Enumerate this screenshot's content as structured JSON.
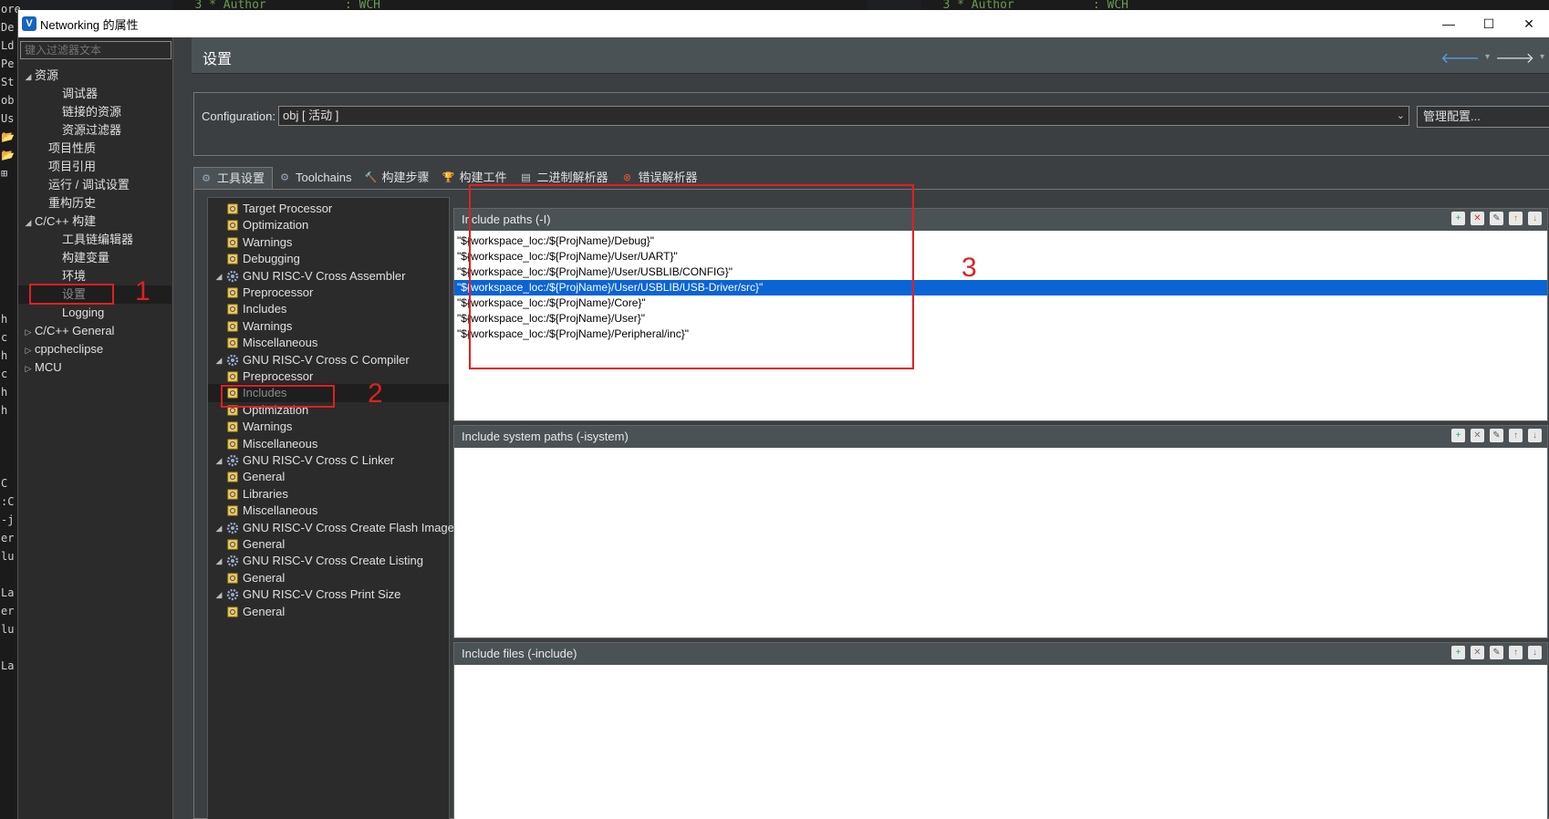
{
  "background": {
    "editor_left_text": "3 * Author           : WCH",
    "editor_right_text": "3 * Author           : WCH",
    "left_strip": [
      "ore",
      "De",
      "Ld",
      "Pe",
      "St",
      "ob",
      "Us",
      "📂",
      "📂",
      "⊞",
      "",
      "",
      "",
      "",
      "",
      "",
      "",
      "h",
      "c",
      "h",
      "c",
      "h",
      "h",
      "",
      "",
      "",
      "C",
      ":C",
      "-j",
      "er",
      "lu",
      "",
      "La",
      "er",
      "lu",
      "",
      "La"
    ]
  },
  "window": {
    "title": "Networking 的属性",
    "minimize": "—",
    "maximize": "☐",
    "close": "✕"
  },
  "leftnav": {
    "filter_placeholder": "键入过滤器文本",
    "items": [
      {
        "label": "资源",
        "indent": 0,
        "toggle": "◢"
      },
      {
        "label": "调试器",
        "indent": 2,
        "toggle": ""
      },
      {
        "label": "链接的资源",
        "indent": 2,
        "toggle": ""
      },
      {
        "label": "资源过滤器",
        "indent": 2,
        "toggle": ""
      },
      {
        "label": "项目性质",
        "indent": 1,
        "toggle": ""
      },
      {
        "label": "项目引用",
        "indent": 1,
        "toggle": ""
      },
      {
        "label": "运行 / 调试设置",
        "indent": 1,
        "toggle": ""
      },
      {
        "label": "重构历史",
        "indent": 1,
        "toggle": ""
      },
      {
        "label": "C/C++ 构建",
        "indent": 0,
        "toggle": "◢"
      },
      {
        "label": "工具链编辑器",
        "indent": 2,
        "toggle": ""
      },
      {
        "label": "构建变量",
        "indent": 2,
        "toggle": ""
      },
      {
        "label": "环境",
        "indent": 2,
        "toggle": ""
      },
      {
        "label": "设置",
        "indent": 2,
        "toggle": "",
        "selected": true
      },
      {
        "label": "Logging",
        "indent": 2,
        "toggle": ""
      },
      {
        "label": "C/C++ General",
        "indent": 0,
        "toggle": "▷"
      },
      {
        "label": "cppcheclipse",
        "indent": 0,
        "toggle": "▷"
      },
      {
        "label": "MCU",
        "indent": 0,
        "toggle": "▷"
      }
    ]
  },
  "main": {
    "title": "设置",
    "nav_back": "🡐",
    "nav_forward": "🡒",
    "nav_dropdown": "▾",
    "config_label": "Configuration:",
    "config_value": "obj  [ 活动 ]",
    "config_arrow": "⌄",
    "manage_button": "管理配置...",
    "tabs": [
      {
        "label": "工具设置",
        "icon": "⚙",
        "active": true
      },
      {
        "label": "Toolchains",
        "icon": "⚙",
        "active": false
      },
      {
        "label": "构建步骤",
        "icon": "🔨",
        "active": false
      },
      {
        "label": "构建工件",
        "icon": "🏆",
        "active": false
      },
      {
        "label": "二进制解析器",
        "icon": "▤",
        "active": false
      },
      {
        "label": "错误解析器",
        "icon": "⊗",
        "active": false
      }
    ]
  },
  "tooltree": {
    "items": [
      {
        "label": "Target Processor",
        "level": 1,
        "toggle": ""
      },
      {
        "label": "Optimization",
        "level": 1,
        "toggle": ""
      },
      {
        "label": "Warnings",
        "level": 1,
        "toggle": ""
      },
      {
        "label": "Debugging",
        "level": 1,
        "toggle": ""
      },
      {
        "label": "GNU RISC-V Cross Assembler",
        "level": 0,
        "toggle": "◢",
        "group": true
      },
      {
        "label": "Preprocessor",
        "level": 2,
        "toggle": ""
      },
      {
        "label": "Includes",
        "level": 2,
        "toggle": ""
      },
      {
        "label": "Warnings",
        "level": 2,
        "toggle": ""
      },
      {
        "label": "Miscellaneous",
        "level": 2,
        "toggle": ""
      },
      {
        "label": "GNU RISC-V Cross C Compiler",
        "level": 0,
        "toggle": "◢",
        "group": true
      },
      {
        "label": "Preprocessor",
        "level": 2,
        "toggle": ""
      },
      {
        "label": "Includes",
        "level": 2,
        "toggle": "",
        "selected": true
      },
      {
        "label": "Optimization",
        "level": 2,
        "toggle": ""
      },
      {
        "label": "Warnings",
        "level": 2,
        "toggle": ""
      },
      {
        "label": "Miscellaneous",
        "level": 2,
        "toggle": ""
      },
      {
        "label": "GNU RISC-V Cross C Linker",
        "level": 0,
        "toggle": "◢",
        "group": true
      },
      {
        "label": "General",
        "level": 2,
        "toggle": ""
      },
      {
        "label": "Libraries",
        "level": 2,
        "toggle": ""
      },
      {
        "label": "Miscellaneous",
        "level": 2,
        "toggle": ""
      },
      {
        "label": "GNU RISC-V Cross Create Flash Image",
        "level": 0,
        "toggle": "◢",
        "group": true
      },
      {
        "label": "General",
        "level": 2,
        "toggle": ""
      },
      {
        "label": "GNU RISC-V Cross Create Listing",
        "level": 0,
        "toggle": "◢",
        "group": true
      },
      {
        "label": "General",
        "level": 2,
        "toggle": ""
      },
      {
        "label": "GNU RISC-V Cross Print Size",
        "level": 0,
        "toggle": "◢",
        "group": true
      },
      {
        "label": "General",
        "level": 2,
        "toggle": ""
      }
    ]
  },
  "sections": {
    "include_paths": {
      "title": "Include paths (-I)",
      "paths": [
        {
          "text": "\"${workspace_loc:/${ProjName}/Debug}\"",
          "selected": false
        },
        {
          "text": "\"${workspace_loc:/${ProjName}/User/UART}\"",
          "selected": false
        },
        {
          "text": "\"${workspace_loc:/${ProjName}/User/USBLIB/CONFIG}\"",
          "selected": false
        },
        {
          "text": "\"${workspace_loc:/${ProjName}/User/USBLIB/USB-Driver/src}\"",
          "selected": true
        },
        {
          "text": "\"${workspace_loc:/${ProjName}/Core}\"",
          "selected": false
        },
        {
          "text": "\"${workspace_loc:/${ProjName}/User}\"",
          "selected": false
        },
        {
          "text": "\"${workspace_loc:/${ProjName}/Peripheral/inc}\"",
          "selected": false
        }
      ]
    },
    "include_system": {
      "title": "Include system paths (-isystem)"
    },
    "include_files": {
      "title": "Include files (-include)"
    },
    "tool_icons": [
      "add-icon",
      "delete-icon",
      "edit-icon",
      "move-up-icon",
      "move-down-icon"
    ]
  },
  "annotations": {
    "one": "1",
    "two": "2",
    "three": "3",
    "color": "#e02020"
  }
}
